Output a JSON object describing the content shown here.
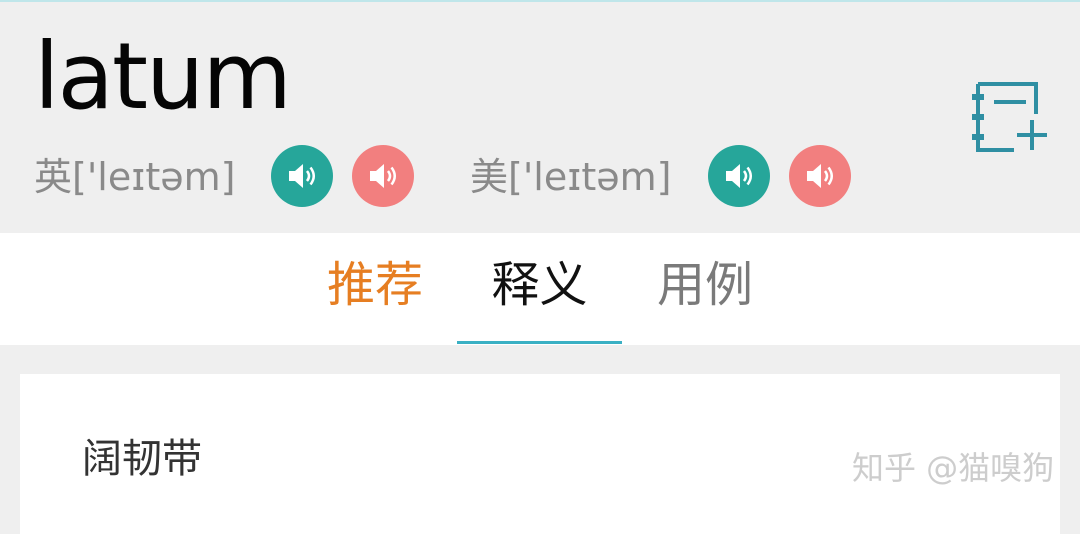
{
  "word": "latum",
  "pronunciations": [
    {
      "region": "英",
      "ipa": "['leɪtəm]",
      "buttons": [
        "speaker-icon",
        "speaker-icon"
      ]
    },
    {
      "region": "美",
      "ipa": "['leɪtəm]",
      "buttons": [
        "speaker-icon",
        "speaker-icon"
      ]
    }
  ],
  "colors": {
    "speaker_primary": "#26a69a",
    "speaker_secondary": "#f27f7f",
    "active_tab_text": "#e67e22",
    "tab_underline": "#3ab0c4",
    "notebook_icon": "#2f8fa3"
  },
  "notebook_button_icon": "notebook-add-icon",
  "tabs": [
    {
      "label": "推荐"
    },
    {
      "label": "释义"
    },
    {
      "label": "用例"
    }
  ],
  "definitions": [
    {
      "text": "阔韧带"
    }
  ],
  "watermark": "知乎 @猫嗅狗"
}
